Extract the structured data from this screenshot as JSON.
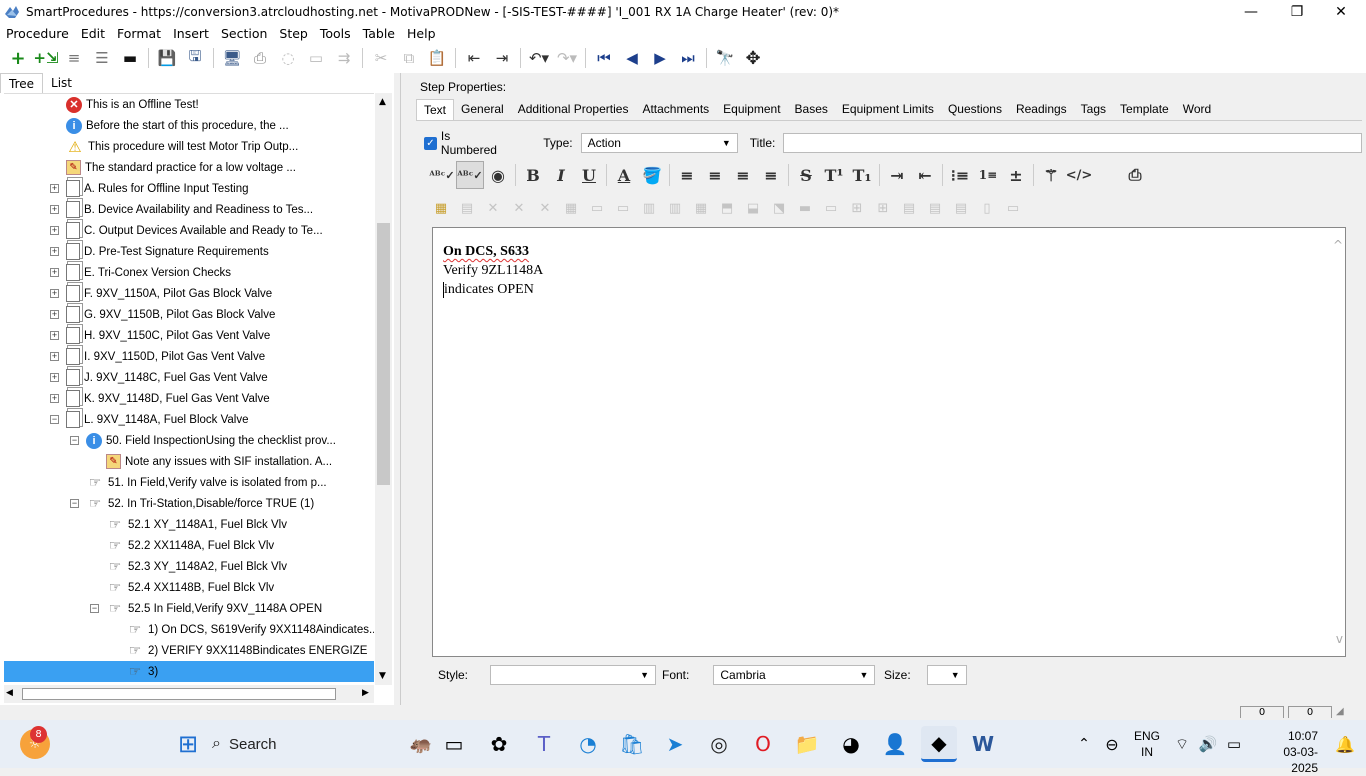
{
  "window": {
    "title": "SmartProcedures - https://conversion3.atrcloudhosting.net - MotivaPRODNew - [-SIS-TEST-####] 'I_001 RX 1A Charge Heater' (rev: 0)*",
    "minimize": "—",
    "maximize": "❐",
    "close": "✕"
  },
  "menu": [
    "Procedure",
    "Edit",
    "Format",
    "Insert",
    "Section",
    "Step",
    "Tools",
    "Table",
    "Help"
  ],
  "left_tabs": [
    "Tree",
    "List"
  ],
  "tree": [
    {
      "label": "This is an Offline Test!",
      "icon": "error-icon",
      "level": 0,
      "exp": ""
    },
    {
      "label": "Before the start of this procedure, the ...",
      "icon": "info-icon",
      "level": 0,
      "exp": ""
    },
    {
      "label": "This procedure will test Motor Trip Outp...",
      "icon": "warning-icon",
      "level": 0,
      "exp": ""
    },
    {
      "label": "The standard practice for a low voltage ...",
      "icon": "note-icon",
      "level": 0,
      "exp": ""
    },
    {
      "label": "A. Rules for Offline Input Testing",
      "icon": "section-icon",
      "level": 0,
      "exp": "+"
    },
    {
      "label": "B. Device Availability and Readiness to Tes...",
      "icon": "section-icon",
      "level": 0,
      "exp": "+"
    },
    {
      "label": "C. Output Devices Available and Ready to Te...",
      "icon": "section-icon",
      "level": 0,
      "exp": "+"
    },
    {
      "label": "D. Pre-Test Signature Requirements",
      "icon": "section-icon",
      "level": 0,
      "exp": "+"
    },
    {
      "label": "E. Tri-Conex Version Checks",
      "icon": "section-icon",
      "level": 0,
      "exp": "+"
    },
    {
      "label": "F. 9XV_1150A, Pilot Gas Block Valve",
      "icon": "section-icon",
      "level": 0,
      "exp": "+"
    },
    {
      "label": "G. 9XV_1150B, Pilot Gas Block Valve",
      "icon": "section-icon",
      "level": 0,
      "exp": "+"
    },
    {
      "label": "H. 9XV_1150C, Pilot Gas Vent Valve",
      "icon": "section-icon",
      "level": 0,
      "exp": "+"
    },
    {
      "label": "I. 9XV_1150D, Pilot Gas Vent Valve",
      "icon": "section-icon",
      "level": 0,
      "exp": "+"
    },
    {
      "label": "J. 9XV_1148C, Fuel Gas Vent Valve",
      "icon": "section-icon",
      "level": 0,
      "exp": "+"
    },
    {
      "label": "K. 9XV_1148D, Fuel Gas Vent Valve",
      "icon": "section-icon",
      "level": 0,
      "exp": "+"
    },
    {
      "label": "L. 9XV_1148A, Fuel Block Valve",
      "icon": "section-icon",
      "level": 0,
      "exp": "−"
    },
    {
      "label": "50. Field InspectionUsing the checklist prov...",
      "icon": "info-icon",
      "level": 1,
      "exp": "−"
    },
    {
      "label": "Note any issues with SIF installation. A...",
      "icon": "note-icon",
      "level": 2,
      "exp": ""
    },
    {
      "label": "51. In Field,Verify valve is isolated from p...",
      "icon": "step-hand-icon",
      "level": 1,
      "exp": ""
    },
    {
      "label": "52. In Tri-Station,Disable/force TRUE (1)",
      "icon": "step-hand-icon",
      "level": 1,
      "exp": "−"
    },
    {
      "label": "52.1 XY_1148A1, Fuel Blck Vlv",
      "icon": "step-hand-icon",
      "level": 2,
      "exp": ""
    },
    {
      "label": "52.2 XX1148A, Fuel Blck Vlv",
      "icon": "step-hand-icon",
      "level": 2,
      "exp": ""
    },
    {
      "label": "52.3 XY_1148A2, Fuel Blck Vlv",
      "icon": "step-hand-icon",
      "level": 2,
      "exp": ""
    },
    {
      "label": "52.4 XX1148B, Fuel Blck Vlv",
      "icon": "step-hand-icon",
      "level": 2,
      "exp": ""
    },
    {
      "label": "52.5 In Field,Verify 9XV_1148A OPEN",
      "icon": "step-hand-icon",
      "level": 2,
      "exp": "−"
    },
    {
      "label": "1) On DCS,  S619Verify  9XX1148Aindicates...",
      "icon": "step-hand-icon",
      "level": 3,
      "exp": ""
    },
    {
      "label": "2) VERIFY 9XX1148Bindicates ENERGIZE",
      "icon": "step-hand-icon",
      "level": 3,
      "exp": ""
    },
    {
      "label": "3)",
      "icon": "step-hand-icon",
      "level": 3,
      "exp": "",
      "selected": true
    }
  ],
  "step_properties": {
    "heading": "Step Properties:",
    "tabs": [
      "Text",
      "General",
      "Additional Properties",
      "Attachments",
      "Equipment",
      "Bases",
      "Equipment Limits",
      "Questions",
      "Readings",
      "Tags",
      "Template",
      "Word"
    ],
    "is_numbered_label": "Is Numbered",
    "type_label": "Type:",
    "type_value": "Action",
    "title_label": "Title:",
    "title_value": ""
  },
  "editor": {
    "line1": "On DCS, S633",
    "line2": "Verify 9ZL1148A",
    "line3": "indicates OPEN"
  },
  "bottom": {
    "style_label": "Style:",
    "style_value": "",
    "font_label": "Font:",
    "font_value": "Cambria",
    "size_label": "Size:",
    "size_value": ""
  },
  "statusbar": {
    "v1": "0",
    "v2": "0"
  },
  "taskbar": {
    "search_label": "Search",
    "lang": "ENG",
    "lang2": "IN",
    "time": "10:07",
    "date": "03-03-2025",
    "notification_badge": "8"
  },
  "colors": {
    "accent": "#1f6fd1",
    "selection": "#3399ff",
    "tree_selected": "#3aa0f2"
  }
}
